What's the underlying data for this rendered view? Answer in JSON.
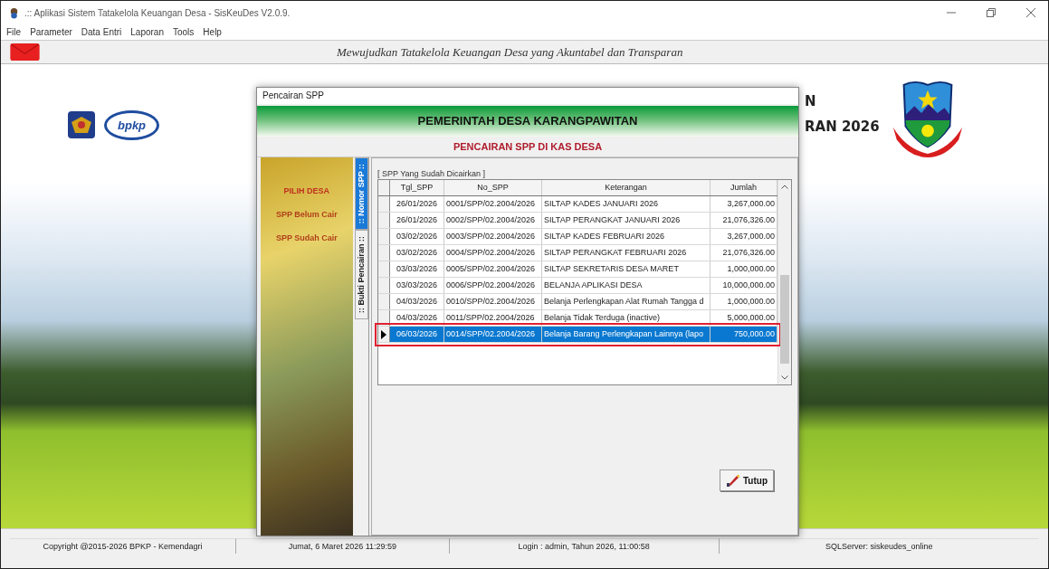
{
  "window": {
    "title": ".:: Aplikasi Sistem Tatakelola Keuangan Desa - SisKeuDes V2.0.9."
  },
  "menu": [
    "File",
    "Parameter",
    "Data Entri",
    "Laporan",
    "Tools",
    "Help"
  ],
  "banner": {
    "slogan": "Mewujudkan Tatakelola Keuangan Desa yang Akuntabel dan Transparan"
  },
  "desktop": {
    "logo_text": "bpkp",
    "heading_lines": [
      "N",
      "RAN 2026"
    ]
  },
  "dialog": {
    "title": "Pencairan SPP",
    "header": "PEMERINTAH DESA KARANGPAWITAN",
    "subheader": "PENCAIRAN SPP DI KAS DESA",
    "side_menu": [
      "PILIH DESA",
      "SPP Belum Cair",
      "SPP Sudah Cair"
    ],
    "tabs": [
      {
        "label": ":: Nomor SPP ::",
        "selected": true
      },
      {
        "label": ":: Bukti Pencairan ::",
        "selected": false
      }
    ],
    "group_title": "[ SPP Yang Sudah Dicairkan ]",
    "table": {
      "columns": [
        "Tgl_SPP",
        "No_SPP",
        "Keterangan",
        "Jumlah"
      ],
      "rows": [
        {
          "cells": [
            "26/01/2026",
            "0001/SPP/02.2004/2026",
            "SILTAP KADES JANUARI 2026",
            "3,267,000.00"
          ],
          "selected": false
        },
        {
          "cells": [
            "26/01/2026",
            "0002/SPP/02.2004/2026",
            "SILTAP PERANGKAT JANUARI 2026",
            "21,076,326.00"
          ],
          "selected": false
        },
        {
          "cells": [
            "03/02/2026",
            "0003/SPP/02.2004/2026",
            "SILTAP KADES FEBRUARI 2026",
            "3,267,000.00"
          ],
          "selected": false
        },
        {
          "cells": [
            "03/02/2026",
            "0004/SPP/02.2004/2026",
            "SILTAP PERANGKAT FEBRUARI 2026",
            "21,076,326.00"
          ],
          "selected": false
        },
        {
          "cells": [
            "03/03/2026",
            "0005/SPP/02.2004/2026",
            "SILTAP SEKRETARIS DESA MARET",
            "1,000,000.00"
          ],
          "selected": false
        },
        {
          "cells": [
            "03/03/2026",
            "0006/SPP/02.2004/2026",
            "BELANJA APLIKASI DESA",
            "10,000,000.00"
          ],
          "selected": false
        },
        {
          "cells": [
            "04/03/2026",
            "0010/SPP/02.2004/2026",
            "Belanja Perlengkapan Alat Rumah Tangga d",
            "1,000,000.00"
          ],
          "selected": false
        },
        {
          "cells": [
            "04/03/2026",
            "0011/SPP/02.2004/2026",
            "Belanja Tidak Terduga (inactive)",
            "5,000,000.00"
          ],
          "selected": false
        },
        {
          "cells": [
            "06/03/2026",
            "0014/SPP/02.2004/2026",
            "Belanja Barang Perlengkapan Lainnya (lapo",
            "750,000.00"
          ],
          "selected": true
        }
      ]
    },
    "close_button": "Tutup"
  },
  "status_bar": [
    "Copyright @2015-2026 BPKP - Kemendagri",
    "Jumat, 6 Maret 2026 11:29:59",
    "Login : admin,  Tahun 2026, 11:00:58",
    "SQLServer: siskeudes_online"
  ]
}
